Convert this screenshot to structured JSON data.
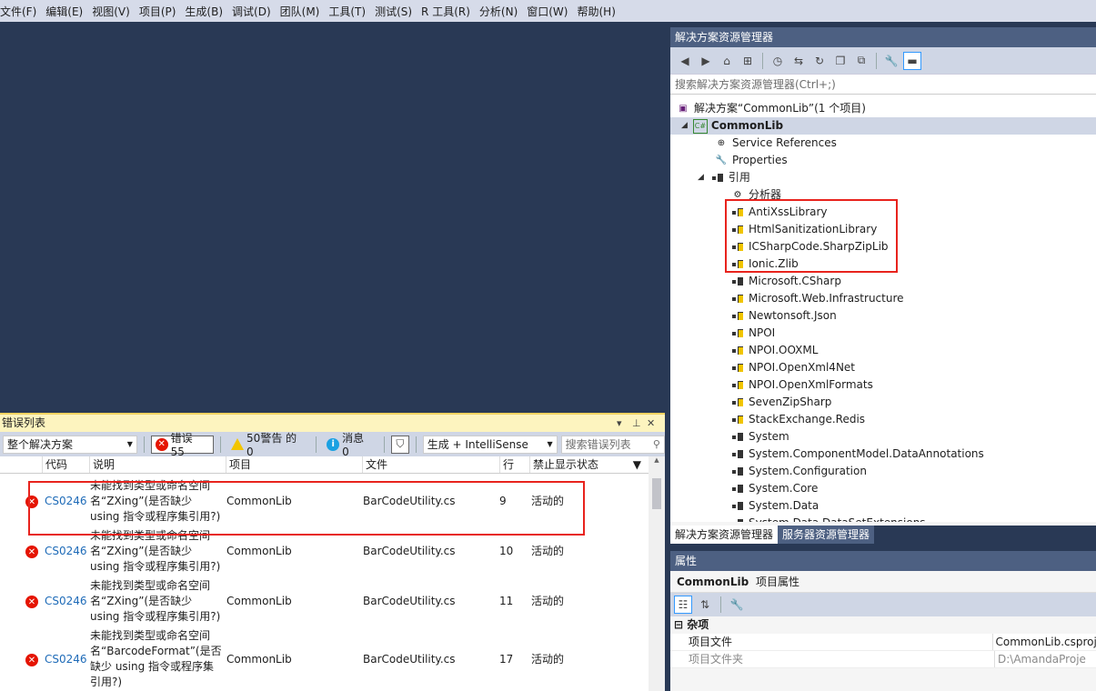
{
  "menu": [
    "文件(F)",
    "编辑(E)",
    "视图(V)",
    "项目(P)",
    "生成(B)",
    "调试(D)",
    "团队(M)",
    "工具(T)",
    "测试(S)",
    "R 工具(R)",
    "分析(N)",
    "窗口(W)",
    "帮助(H)"
  ],
  "solution_explorer": {
    "title": "解决方案资源管理器",
    "search_placeholder": "搜索解决方案资源管理器(Ctrl+;)",
    "solution_label": "解决方案“CommonLib”(1 个项目)",
    "project": "CommonLib",
    "service_refs": "Service References",
    "properties": "Properties",
    "references": "引用",
    "analyzers": "分析器",
    "refs": [
      "AntiXssLibrary",
      "HtmlSanitizationLibrary",
      "ICSharpCode.SharpZipLib",
      "Ionic.Zlib",
      "Microsoft.CSharp",
      "Microsoft.Web.Infrastructure",
      "Newtonsoft.Json",
      "NPOI",
      "NPOI.OOXML",
      "NPOI.OpenXml4Net",
      "NPOI.OpenXmlFormats",
      "SevenZipSharp",
      "StackExchange.Redis",
      "System",
      "System.ComponentModel.DataAnnotations",
      "System.Configuration",
      "System.Core",
      "System.Data",
      "System.Data.DataSetExtensions"
    ],
    "tabs": [
      "解决方案资源管理器",
      "服务器资源管理器"
    ]
  },
  "properties": {
    "title": "属性",
    "object": "CommonLib",
    "object_desc": "项目属性",
    "category": "杂项",
    "rows": [
      {
        "key": "项目文件",
        "value": "CommonLib.csproj"
      },
      {
        "key": "项目文件夹",
        "value": "D:\\AmandaProje"
      }
    ]
  },
  "error_list": {
    "title": "错误列表",
    "scope": "整个解决方案",
    "errors_label": "错误 55",
    "warnings_label": "50警告 的 0",
    "messages_label": "消息 0",
    "source": "生成 + IntelliSense",
    "search_placeholder": "搜索错误列表",
    "columns": [
      "代码",
      "说明",
      "项目",
      "文件",
      "行",
      "禁止显示状态"
    ],
    "rows": [
      {
        "code": "CS0246",
        "desc": "未能找到类型或命名空间名“ZXing”(是否缺少 using 指令或程序集引用?)",
        "project": "CommonLib",
        "file": "BarCodeUtility.cs",
        "line": "9",
        "state": "活动的"
      },
      {
        "code": "CS0246",
        "desc": "未能找到类型或命名空间名“ZXing”(是否缺少 using 指令或程序集引用?)",
        "project": "CommonLib",
        "file": "BarCodeUtility.cs",
        "line": "10",
        "state": "活动的"
      },
      {
        "code": "CS0246",
        "desc": "未能找到类型或命名空间名“ZXing”(是否缺少 using 指令或程序集引用?)",
        "project": "CommonLib",
        "file": "BarCodeUtility.cs",
        "line": "11",
        "state": "活动的"
      },
      {
        "code": "CS0246",
        "desc": "未能找到类型或命名空间名“BarcodeFormat”(是否缺少 using 指令或程序集引用?)",
        "project": "CommonLib",
        "file": "BarCodeUtility.cs",
        "line": "17",
        "state": "活动的"
      }
    ]
  },
  "colors": {
    "highlight": "#e8231d",
    "title_bar": "#4d6082",
    "background": "#293955",
    "link": "#1e6bb8"
  }
}
